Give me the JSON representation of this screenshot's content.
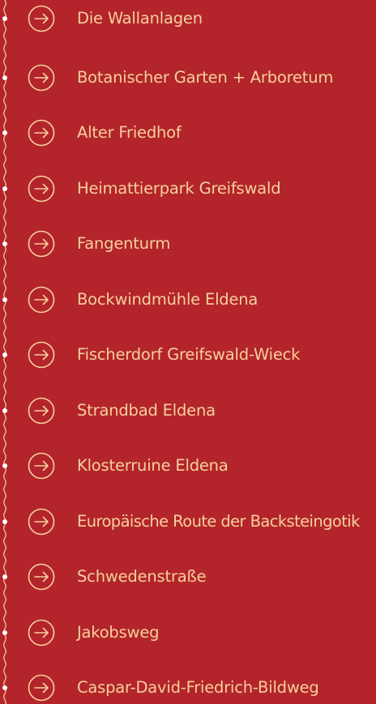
{
  "menu": {
    "arrow_icon": "circle-arrow-right-icon",
    "colors": {
      "background": "#b3252a",
      "text": "#f6cf9e",
      "dot": "#ffffff"
    },
    "items": [
      {
        "label": "Die Wallanlagen"
      },
      {
        "label": "Botanischer Garten + Arboretum"
      },
      {
        "label": "Alter Friedhof"
      },
      {
        "label": "Heimattierpark Greifswald"
      },
      {
        "label": "Fangenturm"
      },
      {
        "label": "Bockwindmühle Eldena"
      },
      {
        "label": "Fischerdorf Greifswald-Wieck"
      },
      {
        "label": "Strandbad Eldena"
      },
      {
        "label": "Klosterruine Eldena"
      },
      {
        "label": "Europäische Route der Backsteingotik"
      },
      {
        "label": "Schwedenstraße"
      },
      {
        "label": "Jakobsweg"
      },
      {
        "label": "Caspar-David-Friedrich-Bildweg"
      }
    ]
  }
}
